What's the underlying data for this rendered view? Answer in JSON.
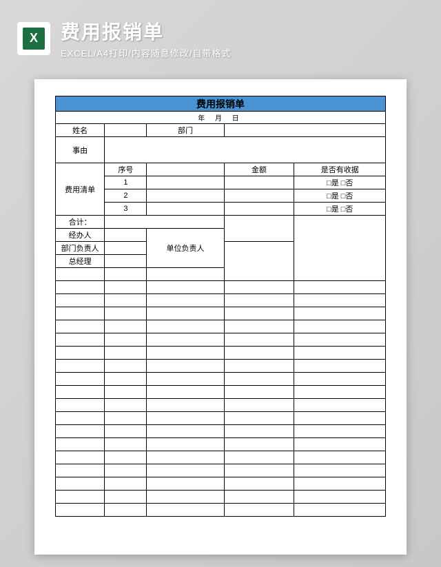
{
  "header": {
    "title": "费用报销单",
    "subtitle": "EXCEL/A4打印/内容随意修改/自带格式",
    "icon_letter": "X"
  },
  "form": {
    "title": "费用报销单",
    "date": "年  月  日",
    "labels": {
      "name": "姓名",
      "dept": "部门",
      "reason": "事由",
      "expense_list": "费用清单",
      "seq": "序号",
      "amount": "金额",
      "receipt": "是否有收据",
      "total": "合计：",
      "handler": "经办人",
      "unit_head": "单位负责人",
      "dept_head": "部门负责人",
      "gm": "总经理"
    },
    "rows": [
      {
        "seq": "1",
        "receipt": "□是 □否"
      },
      {
        "seq": "2",
        "receipt": "□是 □否"
      },
      {
        "seq": "3",
        "receipt": "□是 □否"
      }
    ]
  }
}
